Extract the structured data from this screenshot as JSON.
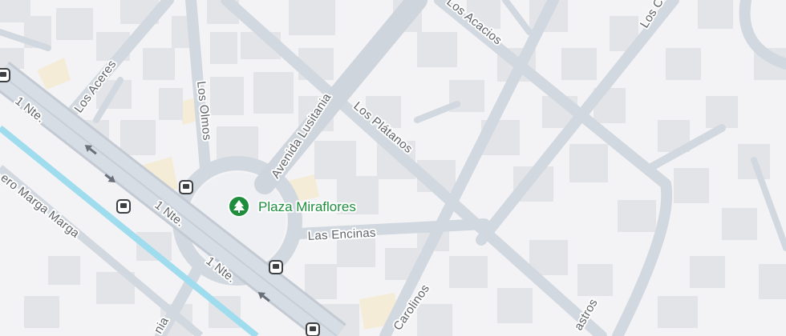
{
  "map": {
    "colors": {
      "background": "#f3f3f5",
      "building": "#e3e4e8",
      "road": "#d2d8df",
      "road_edge": "#c3cad3",
      "main_road": "#c6ced8",
      "river": "#9fdcee",
      "park": "#f4ecd6",
      "poi_green": "#1e8e3e",
      "label": "#5f6368",
      "bus_stop": "#3c4043"
    },
    "poi": {
      "name": "Plaza Miraflores",
      "icon": "park-tree-icon"
    },
    "streets": {
      "los_acacios": "Los Acacios",
      "los_aceres": "Los Aceres",
      "los_olmos": "Los Olmos",
      "avenida_lusitania": "Avenida Lusitania",
      "los_platanos": "Los Plátanos",
      "las_encinas": "Las Encinas",
      "carolinos": "Carolinos",
      "castros": "astros",
      "los_c": "Los C",
      "norte_1": "1 Nte.",
      "norte_2": "1 Nte.",
      "norte_3": "1 Nte.",
      "norte_4": "1 Nte.",
      "estero": "ero Marga Marga",
      "bottom_left": "nia"
    },
    "icons": {
      "bus_stop": "bus-stop-icon",
      "one_way_arrow": "one-way-arrow-icon"
    }
  }
}
